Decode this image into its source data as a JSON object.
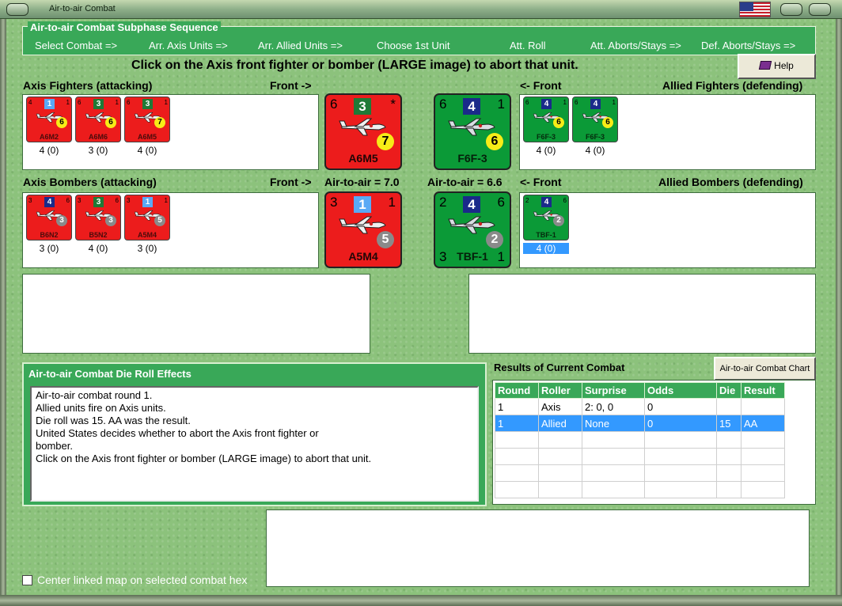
{
  "window": {
    "title": "Air-to-air Combat"
  },
  "sequence": {
    "title": "Air-to-air Combat Subphase Sequence",
    "steps": [
      "Select Combat =>",
      "Arr. Axis Units =>",
      "Arr. Allied Units =>",
      "Choose 1st Unit",
      "Att. Roll",
      "Att. Aborts/Stays =>",
      "Def. Aborts/Stays =>"
    ]
  },
  "instruction": "Click on the Axis front fighter or bomber  (LARGE image) to abort that unit.",
  "help_label": "Help",
  "labels": {
    "axis_fighters": "Axis Fighters (attacking)",
    "front_right": "Front ->",
    "front_left": "<- Front",
    "allied_fighters": "Allied Fighters (defending)",
    "axis_bombers": "Axis Bombers (attacking)",
    "air_axis": "Air-to-air = 7.0",
    "air_allied": "Air-to-air = 6.6",
    "allied_bombers": "Allied Bombers (defending)"
  },
  "axis_fighters": [
    {
      "name": "A6M2",
      "left": "4",
      "right": "1",
      "sq": "1",
      "sq_color": "lblue",
      "circ": "6",
      "circ_color": "yellow",
      "caption": "4 (0)"
    },
    {
      "name": "A6M6",
      "left": "6",
      "right": "1",
      "sq": "3",
      "sq_color": "green",
      "circ": "6",
      "circ_color": "yellow",
      "caption": "3 (0)"
    },
    {
      "name": "A6M5",
      "left": "6",
      "right": "1",
      "sq": "3",
      "sq_color": "green",
      "circ": "7",
      "circ_color": "yellow",
      "caption": "4 (0)"
    }
  ],
  "allied_fighters": [
    {
      "name": "F6F-3",
      "left": "6",
      "right": "1",
      "sq": "4",
      "sq_color": "blue",
      "circ": "6",
      "circ_color": "yellow",
      "caption": "4 (0)"
    },
    {
      "name": "F6F-3",
      "left": "6",
      "right": "1",
      "sq": "4",
      "sq_color": "blue",
      "circ": "6",
      "circ_color": "yellow",
      "caption": "4 (0)"
    }
  ],
  "axis_bombers": [
    {
      "name": "B6N2",
      "left": "3",
      "right": "6",
      "sq": "4",
      "sq_color": "blue",
      "circ": "3",
      "circ_color": "gray",
      "caption": "3 (0)"
    },
    {
      "name": "B5N2",
      "left": "3",
      "right": "6",
      "sq": "3",
      "sq_color": "green",
      "circ": "3",
      "circ_color": "gray",
      "caption": "4 (0)"
    },
    {
      "name": "A5M4",
      "left": "3",
      "right": "1",
      "sq": "1",
      "sq_color": "lblue",
      "circ": "5",
      "circ_color": "gray",
      "caption": "3 (0)"
    }
  ],
  "allied_bombers": [
    {
      "name": "TBF-1",
      "left": "2",
      "right": "6",
      "sq": "4",
      "sq_color": "blue",
      "circ": "2",
      "circ_color": "gray",
      "caption": "4 (0)"
    }
  ],
  "front_units": {
    "axis_fighter": {
      "name": "A6M5",
      "left": "6",
      "right": "*",
      "sq": "3",
      "sq_color": "green",
      "circ": "7",
      "circ_color": "yellow"
    },
    "allied_fighter": {
      "name": "F6F-3",
      "left": "6",
      "right": "1",
      "sq": "4",
      "sq_color": "blue",
      "circ": "6",
      "circ_color": "yellow"
    },
    "axis_bomber": {
      "name": "A5M4",
      "left": "3",
      "right": "1",
      "sq": "1",
      "sq_color": "lblue",
      "circ": "5",
      "circ_color": "gray"
    },
    "allied_bomber": {
      "name": "TBF-1",
      "left": "2",
      "right": "6",
      "bl": "3",
      "br": "1",
      "sq": "4",
      "sq_color": "blue",
      "circ": "2",
      "circ_color": "gray"
    }
  },
  "effects": {
    "title": "Air-to-air Combat Die Roll Effects",
    "lines": [
      "Air-to-air combat round 1.",
      "Allied units fire on Axis units.",
      "Die roll was 15.  AA was the result.",
      "United States decides whether to abort the Axis front fighter or",
      "bomber.",
      "Click on the Axis front fighter or bomber  (LARGE image) to abort that unit."
    ]
  },
  "results": {
    "title": "Results of Current Combat",
    "chart_button": "Air-to-air Combat Chart",
    "columns": [
      "Round",
      "Roller",
      "Surprise",
      "Odds",
      "Die",
      "Result"
    ],
    "rows": [
      [
        "1",
        "Axis",
        "2: 0, 0",
        "0",
        "",
        ""
      ],
      [
        "1",
        "Allied",
        "None",
        "0",
        "15",
        "AA"
      ]
    ]
  },
  "options": {
    "center_map": "Center linked map on selected combat hex"
  }
}
